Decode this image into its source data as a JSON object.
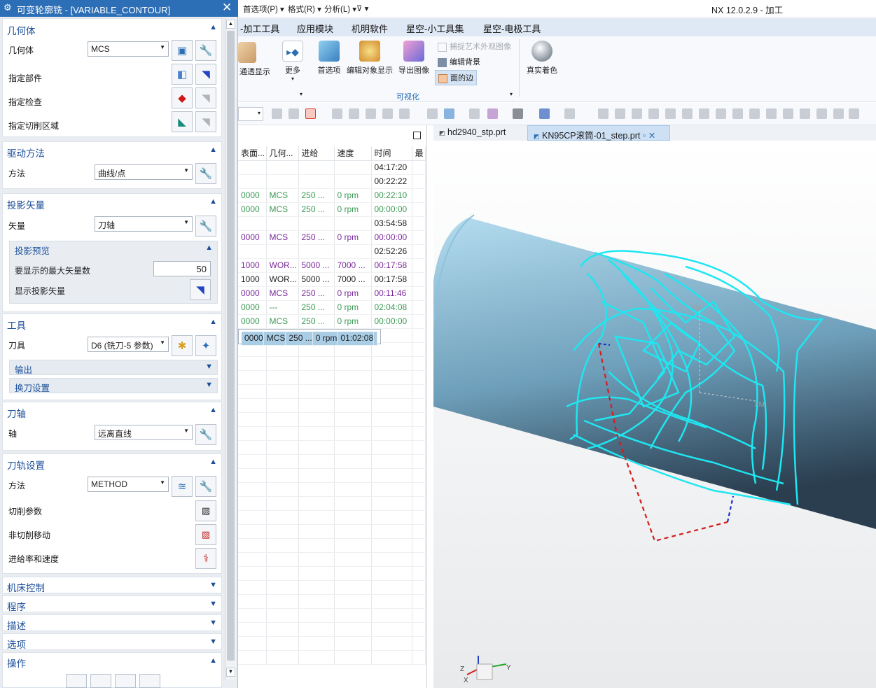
{
  "quick_access": {
    "menus": [
      "首选项(P) ▾",
      "格式(R) ▾",
      "分析(L) ▾"
    ],
    "app_title": "NX 12.0.2.9 - 加工"
  },
  "ribbon_tabs": [
    "-加工工具",
    "应用模块",
    "机明软件",
    "星空-小工具集",
    "星空-电极工具"
  ],
  "ribbon": {
    "translucency_label": "通透显示",
    "more_label": "更多",
    "prefs_label": "首选项",
    "edit_obj_label": "编辑对象显示",
    "export_img_label": "导出图像",
    "capture_label": "捕捉艺术外观图像",
    "edit_bg_label": "编辑背景",
    "face_edge_label": "面的边",
    "group_label": "可视化",
    "true_shading_label": "真实着色"
  },
  "dialog": {
    "title": "可变轮廓铣 - [VARIABLE_CONTOUR]",
    "geometry": {
      "header": "几何体",
      "geometry_label": "几何体",
      "geometry_value": "MCS",
      "part_label": "指定部件",
      "check_label": "指定检查",
      "trim_label": "指定切削区域"
    },
    "drive": {
      "header": "驱动方法",
      "method_label": "方法",
      "method_value": "曲线/点"
    },
    "projection": {
      "header": "投影矢量",
      "vector_label": "矢量",
      "vector_value": "刀轴",
      "preview_header": "投影预览",
      "max_label": "要显示的最大矢量数",
      "max_value": "50",
      "show_label": "显示投影矢量"
    },
    "tool": {
      "header": "工具",
      "tool_label": "刀具",
      "tool_value": "D6 (铣刀-5 参数)",
      "output_label": "输出",
      "change_label": "换刀设置"
    },
    "axis": {
      "header": "刀轴",
      "axis_label": "轴",
      "axis_value": "远离直线"
    },
    "path": {
      "header": "刀轨设置",
      "method_label": "方法",
      "method_value": "METHOD",
      "cut_label": "切削参数",
      "noncut_label": "非切削移动",
      "feed_label": "进给率和速度"
    },
    "collapsed": [
      "机床控制",
      "程序",
      "描述",
      "选项"
    ],
    "ops_header": "操作"
  },
  "op_list": {
    "columns": [
      "表面...",
      "几何...",
      "进给",
      "速度",
      "时间",
      "最"
    ],
    "rows": [
      {
        "c": [
          "",
          "",
          "",
          "",
          "04:17:20",
          ""
        ],
        "style": "dk"
      },
      {
        "c": [
          "",
          "",
          "",
          "",
          "00:22:22",
          ""
        ],
        "style": "dk"
      },
      {
        "c": [
          "0000",
          "MCS",
          "250 ...",
          "0 rpm",
          "00:22:10",
          ""
        ],
        "style": "g"
      },
      {
        "c": [
          "0000",
          "MCS",
          "250 ...",
          "0 rpm",
          "00:00:00",
          ""
        ],
        "style": "g"
      },
      {
        "c": [
          "",
          "",
          "",
          "",
          "03:54:58",
          ""
        ],
        "style": "dk"
      },
      {
        "c": [
          "0000",
          "MCS",
          "250 ...",
          "0 rpm",
          "00:00:00",
          ""
        ],
        "style": "p"
      },
      {
        "c": [
          "",
          "",
          "",
          "",
          "02:52:26",
          ""
        ],
        "style": "dk"
      },
      {
        "c": [
          "1000",
          "WOR...",
          "5000 ...",
          "7000 ...",
          "00:17:58",
          ""
        ],
        "style": "p"
      },
      {
        "c": [
          "1000",
          "WOR...",
          "5000 ...",
          "7000 ...",
          "00:17:58",
          ""
        ],
        "style": "dk"
      },
      {
        "c": [
          "0000",
          "MCS",
          "250 ...",
          "0 rpm",
          "00:11:46",
          ""
        ],
        "style": "p"
      },
      {
        "c": [
          "0000",
          "---",
          "250 ...",
          "0 rpm",
          "02:04:08",
          ""
        ],
        "style": "g"
      },
      {
        "c": [
          "0000",
          "MCS",
          "250 ...",
          "0 rpm",
          "00:00:00",
          ""
        ],
        "style": "g"
      },
      {
        "c": [
          "0000",
          "MCS",
          "250 ...",
          "0 rpm",
          "01:02:08",
          ""
        ],
        "style": "sel"
      }
    ]
  },
  "viewport_tabs": [
    "hd2940_stp.prt",
    "KN95CP滚筒-01_step.prt"
  ],
  "csys_labels": {
    "y": "YM",
    "x": "XM",
    "z": "Z",
    "y2": "Y",
    "x2": "X"
  },
  "colors": {
    "toolpath": "#1fe6f0",
    "cylinder": "#a8d3ea",
    "title_bar": "#2c6fb6",
    "selected_row": "#aacde6"
  }
}
